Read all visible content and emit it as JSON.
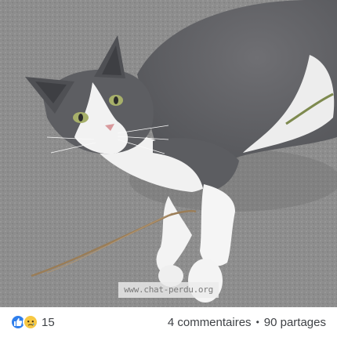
{
  "photo": {
    "subject": "grey-and-white-cat-lying-on-pavement",
    "watermark": "www.chat-perdu.org"
  },
  "reactions": {
    "icons": [
      "like-icon",
      "sad-icon"
    ],
    "count": "15"
  },
  "meta": {
    "comments": "4 commentaires",
    "separator": "•",
    "shares": "90 partages"
  },
  "colors": {
    "like_blue": "#2f7fec",
    "sad_yellow": "#f7c843",
    "text": "#3f4246"
  }
}
